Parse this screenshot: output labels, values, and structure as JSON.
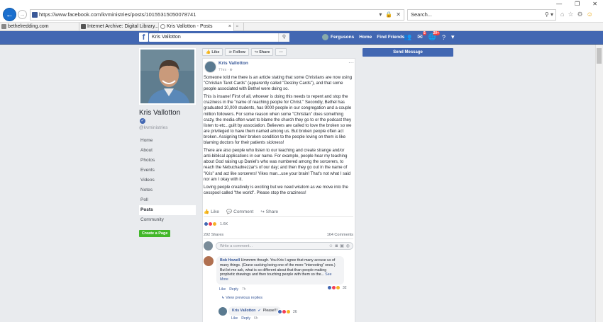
{
  "browser": {
    "url": "https://www.facebook.com/kvministries/posts/10155315050078741",
    "search_placeholder": "Search...",
    "tabs": [
      {
        "label": "bethelredding.com"
      },
      {
        "label": "Internet Archive: Digital Library..."
      },
      {
        "label": "Kris Vallotton - Posts"
      }
    ]
  },
  "fb": {
    "logo": "f",
    "search_value": "Kris Vallotton",
    "user_name": "Fergusons",
    "nav_home": "Home",
    "nav_find_friends": "Find Friends",
    "badge_messages": "5",
    "badge_notifications": "20+"
  },
  "page": {
    "name": "Kris Vallotton",
    "handle": "@kvministries",
    "nav": [
      "Home",
      "About",
      "Photos",
      "Events",
      "Videos",
      "Notes",
      "Poll",
      "Posts",
      "Community"
    ],
    "create_page": "Create a Page",
    "send_message": "Send Message"
  },
  "actions": {
    "like": "Like",
    "follow": "Follow",
    "share": "Share",
    "more": "···"
  },
  "post": {
    "author": "Kris Vallotton",
    "meta": "7 hrs · ⊕",
    "paragraphs": [
      "Someone told me there is an article stating that some Christians are now using \"Christian Tarot Cards\" (apparently called \"Destiny Cards\"), and that some people associated with Bethel were doing so.",
      "This is insane! First of all, whoever is doing this needs to repent and stop the craziness in the \"name of reaching people for Christ.\" Secondly, Bethel has graduated 10,000 students, has 9000 people in our congregation and a couple million followers. For some reason when some \"Christian\" does something crazy, the media often want to blame the church they go to or the podcast they listen to etc...guilt by association. Believers are called to love the broken so we are privileged to have them named among us. But broken people often act broken. Assigning their broken condition to the people loving on them is like blaming doctors for their patients sickness!",
      "There are also people who listen to our teaching and create strange and/or anti-biblical applications in our name. For example, people hear my teaching about God raising up Daniel's who was numbered among the sorcerers, to reach the Nebuchadnezzar's of our day; and then they go out in the name of \"Kris\" and act like sorcerers! Yikes man...use your brain! That's not what I said nor am I okay with it.",
      "Loving people creatively is exciting but we need wisdom as we move into the cesspool called \"the world\". Please stop the craziness!"
    ],
    "like_label": "Like",
    "comment_label": "Comment",
    "share_label": "Share",
    "reaction_count": "1.6K",
    "shares": "292 Shares",
    "comments_count": "164 Comments",
    "comment_placeholder": "Write a comment..."
  },
  "comments": [
    {
      "name": "Bob Howell",
      "text": "Hmmmm though. You Kris I agree that many accuse us of many things. (Grave sucking being one of the more \"interesting\" ones.) But let me ask, what is so different about that than people making prophetic drawings and then touching people with them so the...",
      "see_more": "See More",
      "reactions": "32",
      "like": "Like",
      "reply": "Reply",
      "time": "7h"
    },
    {
      "view_previous": "View previous replies",
      "name": "Kris Vallotton",
      "text": "Please!!!",
      "reactions": "26",
      "like": "Like",
      "reply": "Reply",
      "time": "6h"
    }
  ],
  "colors": {
    "fb_blue": "#4267b2",
    "link": "#385898",
    "green": "#42b72a",
    "bg": "#e9ebee"
  }
}
